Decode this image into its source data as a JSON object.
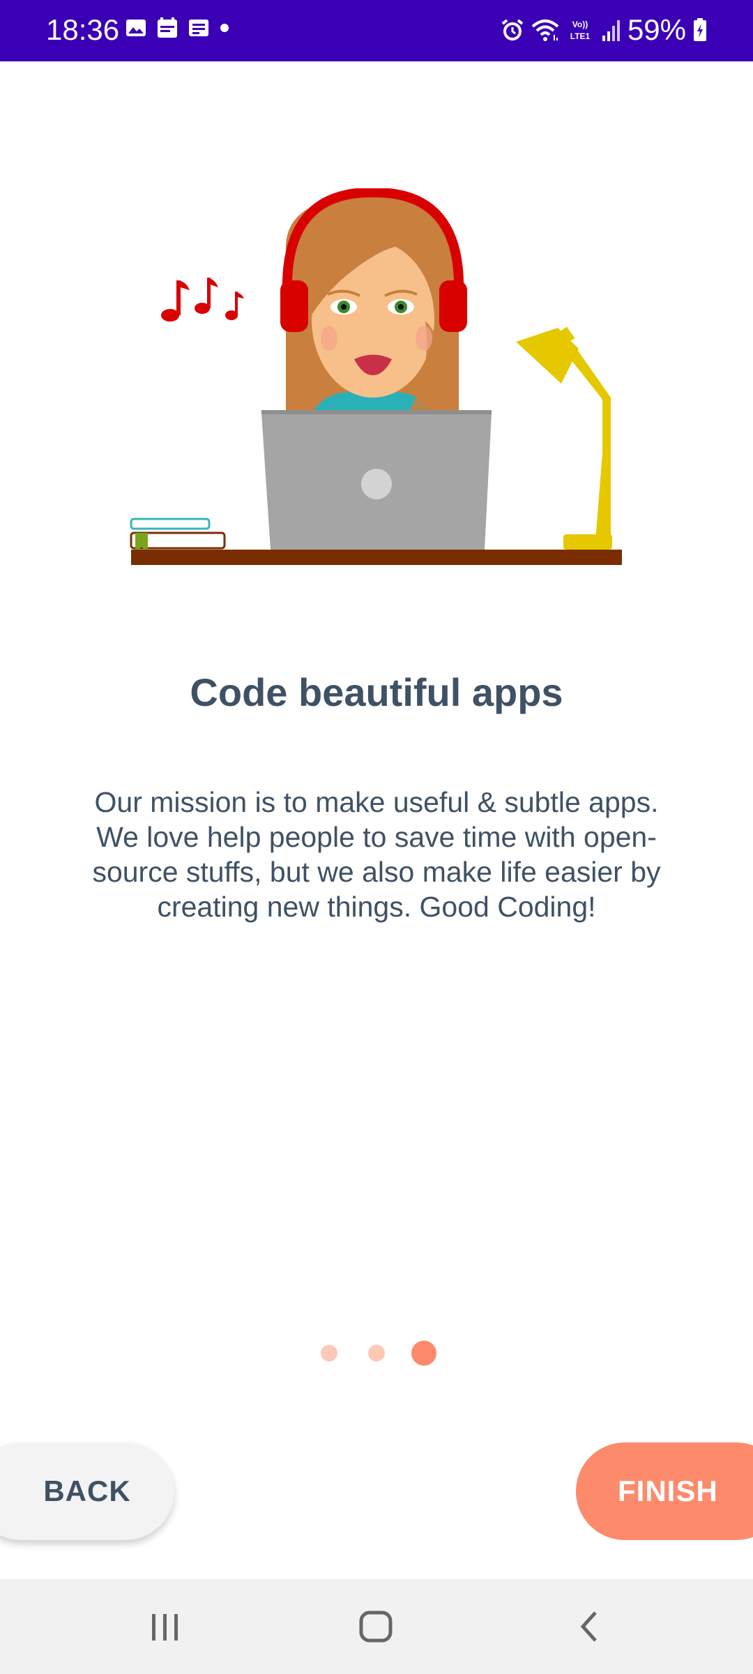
{
  "status_bar": {
    "time": "18:36",
    "battery": "59%",
    "left_icons": [
      "image-icon",
      "calendar-icon",
      "message-icon",
      "dot-icon"
    ],
    "right_icons": [
      "alarm-icon",
      "wifi-icon",
      "volte-icon",
      "signal-icon",
      "battery-charging-icon"
    ],
    "background": "#3b00b5"
  },
  "onboarding": {
    "title": "Code beautiful apps",
    "description": "Our mission is to make useful & subtle apps. We love help people to save time with open-source stuffs, but we also make life easier by creating new things. Good Coding!",
    "page_count": 3,
    "current_page": 3
  },
  "buttons": {
    "back_label": "BACK",
    "finish_label": "FINISH",
    "accent": "#fd8b6b"
  },
  "nav_bar": {
    "icons": [
      "recent-apps-icon",
      "home-icon",
      "back-icon"
    ]
  }
}
